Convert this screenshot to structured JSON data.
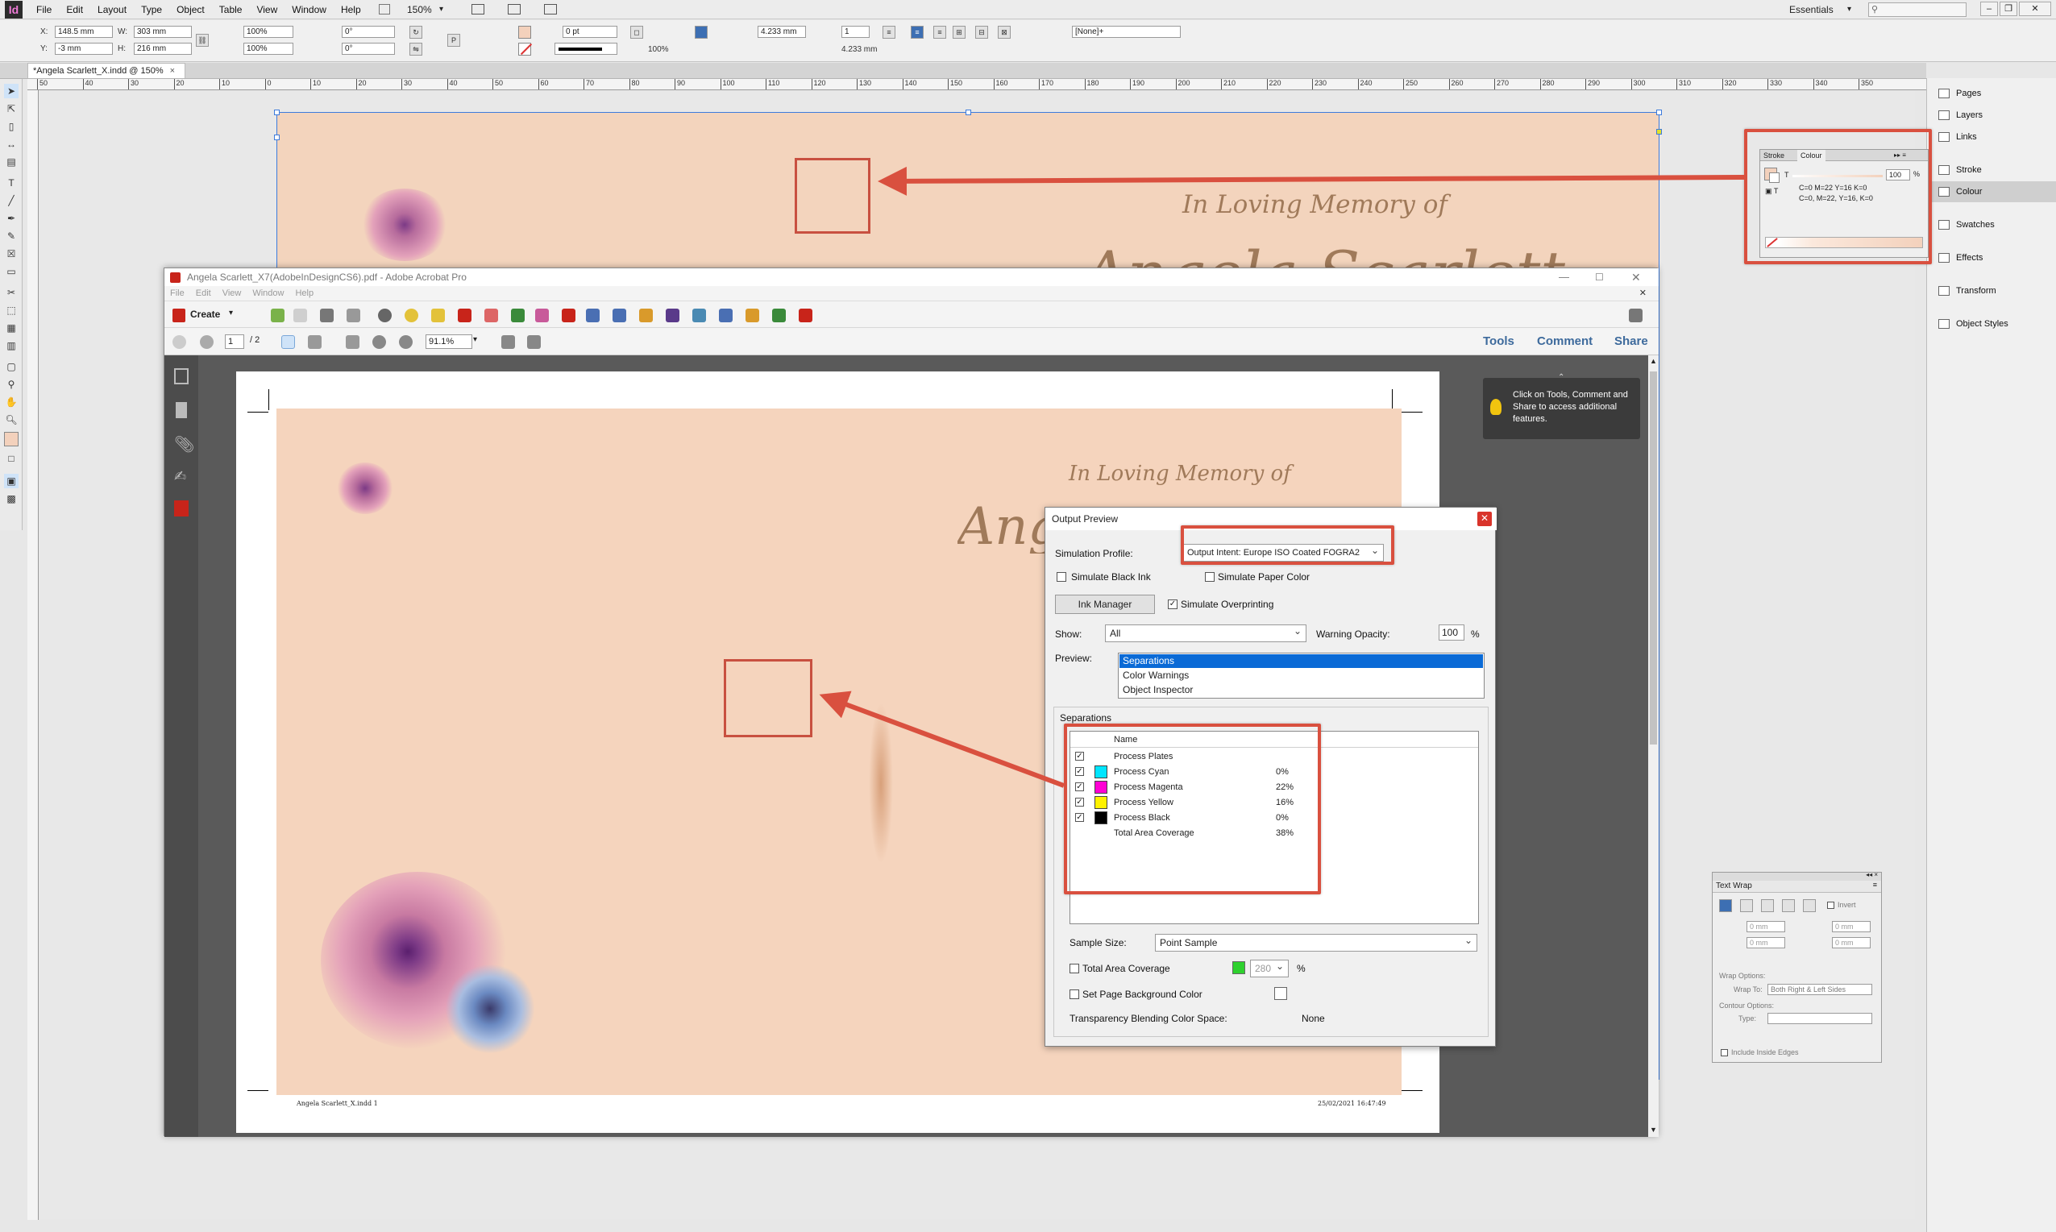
{
  "app": {
    "logo": "Id",
    "menus": [
      "File",
      "Edit",
      "Layout",
      "Type",
      "Object",
      "Table",
      "View",
      "Window",
      "Help"
    ],
    "zoom": "150%",
    "workspace": "Essentials"
  },
  "control": {
    "x_label": "X:",
    "x_value": "148.5 mm",
    "y_label": "Y:",
    "y_value": "-3 mm",
    "w_label": "W:",
    "w_value": "303 mm",
    "h_label": "H:",
    "h_value": "216 mm",
    "scale_x": "100%",
    "scale_y": "100%",
    "angle": "0°",
    "shear": "0°",
    "stroke_weight": "0 pt",
    "opacity": "100%",
    "ref_w": "4.233 mm",
    "ref_h": "4.233 mm",
    "columns": "1",
    "style": "[None]+"
  },
  "document": {
    "tab_title": "*Angela Scarlett_X.indd @ 150%",
    "ruler_ticks": [
      "50",
      "40",
      "30",
      "20",
      "10",
      "0",
      "10",
      "20",
      "30",
      "40",
      "50",
      "60",
      "70",
      "80",
      "90",
      "100",
      "110",
      "120",
      "130",
      "140",
      "150",
      "160",
      "170",
      "180",
      "190",
      "200",
      "210",
      "220",
      "230",
      "240",
      "250",
      "260",
      "270",
      "280",
      "290",
      "300",
      "310",
      "320",
      "330",
      "340",
      "350"
    ],
    "heading": "In Loving Memory of",
    "name_partial": "Angela Scarlett"
  },
  "colour_panel": {
    "tab_stroke": "Stroke",
    "tab_colour": "Colour",
    "tint": "100",
    "tint_unit": "%",
    "cmyk_line1": "C=0 M=22 Y=16 K=0",
    "cmyk_line2": "C=0, M=22, Y=16, K=0",
    "swatch": "#f3d1bc"
  },
  "panels": [
    "Pages",
    "Layers",
    "Links",
    "Stroke",
    "Colour",
    "Swatches",
    "Effects",
    "Transform",
    "Object Styles"
  ],
  "textwrap": {
    "title": "Text Wrap",
    "invert": "Invert",
    "offset_top": "0 mm",
    "offset_bottom": "0 mm",
    "offset_left": "0 mm",
    "offset_right": "0 mm",
    "wrap_options": "Wrap Options:",
    "wrap_to_label": "Wrap To:",
    "wrap_to": "Both Right & Left Sides",
    "contour_options": "Contour Options:",
    "type_label": "Type:",
    "include_inside": "Include Inside Edges"
  },
  "acrobat": {
    "title": "Angela Scarlett_X7(AdobeInDesignCS6).pdf - Adobe Acrobat Pro",
    "menus": [
      "File",
      "Edit",
      "View",
      "Window",
      "Help"
    ],
    "create": "Create",
    "page_current": "1",
    "page_total": "/ 2",
    "zoom": "91.1%",
    "tools": "Tools",
    "comment": "Comment",
    "share": "Share",
    "tip": "Click on Tools, Comment and Share to access additional features.",
    "pdf_heading": "In Loving Memory of",
    "footer_left": "Angela Scarlett_X.indd 1",
    "footer_right": "25/02/2021 16:47:49"
  },
  "output_preview": {
    "title": "Output Preview",
    "simulation_label": "Simulation Profile:",
    "simulation_value": "Output Intent: Europe ISO Coated FOGRA2",
    "simulate_black": "Simulate Black Ink",
    "simulate_paper": "Simulate Paper Color",
    "ink_manager": "Ink Manager",
    "simulate_overprinting": "Simulate Overprinting",
    "show_label": "Show:",
    "show_value": "All",
    "warning_label": "Warning Opacity:",
    "warning_value": "100",
    "warning_unit": "%",
    "preview_label": "Preview:",
    "preview_options": [
      "Separations",
      "Color Warnings",
      "Object Inspector"
    ],
    "separations_label": "Separations",
    "col_name": "Name",
    "rows": [
      {
        "name": "Process Plates",
        "value": "",
        "color": ""
      },
      {
        "name": "Process Cyan",
        "value": "0%",
        "color": "#00e5ff"
      },
      {
        "name": "Process Magenta",
        "value": "22%",
        "color": "#ff00d4"
      },
      {
        "name": "Process Yellow",
        "value": "16%",
        "color": "#fff200"
      },
      {
        "name": "Process Black",
        "value": "0%",
        "color": "#000000"
      },
      {
        "name": "Total Area Coverage",
        "value": "38%",
        "color": ""
      }
    ],
    "sample_label": "Sample Size:",
    "sample_value": "Point Sample",
    "tac_label": "Total Area Coverage",
    "tac_value": "280",
    "tac_unit": "%",
    "bg_label": "Set Page Background Color",
    "blend_label": "Transparency Blending Color Space:",
    "blend_value": "None"
  }
}
